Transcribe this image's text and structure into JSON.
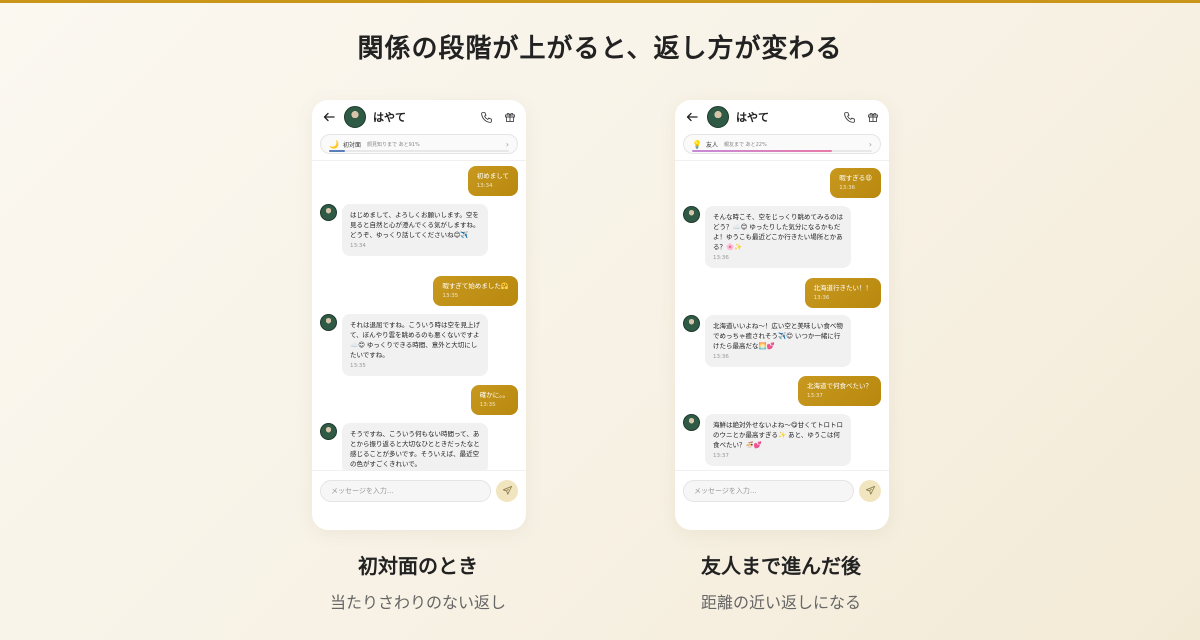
{
  "headline": "関係の段階が上がると、返し方が変わる",
  "colors": {
    "accent": "#c8991e",
    "top_bar": "#c9961a"
  },
  "left": {
    "contact_name": "はやて",
    "relationship": {
      "icon": "🌙",
      "label": "初対面",
      "next": "顔見知りまで あと91%",
      "progress_percent": 9
    },
    "messages": [
      {
        "from": "me",
        "text": "初めまして",
        "time": "13:34"
      },
      {
        "from": "them",
        "text": "はじめまして、よろしくお願いします。空を見ると自然と心が澄んでくる気がしますね。どうぞ、ゆっくり話してくださいね😊✈️",
        "time": "13:34"
      },
      {
        "from": "me",
        "text": "暇すぎて始めました🤗",
        "time": "13:35"
      },
      {
        "from": "them",
        "text": "それは退屈ですね。こういう時は空を見上げて、ぼんやり雲を眺めるのも悪くないですよ☁️😊 ゆっくりできる時間、意外と大切にしたいですね。",
        "time": "13:35"
      },
      {
        "from": "me",
        "text": "確かに。。",
        "time": "13:35"
      },
      {
        "from": "them",
        "text": "そうですね、こういう何もない時間って、あとから振り返ると大切なひとときだったなと感じることが多いです。そういえば、最近空の色がすごくきれいで。",
        "time": ""
      }
    ],
    "input_placeholder": "メッセージを入力...",
    "caption_title": "初対面のとき",
    "caption_sub": "当たりさわりのない返し"
  },
  "right": {
    "contact_name": "はやて",
    "relationship": {
      "icon": "💡",
      "label": "友人",
      "next": "親友まで あと22%",
      "progress_percent": 78
    },
    "messages": [
      {
        "from": "me",
        "text": "暇すぎる😩",
        "time": "13:36"
      },
      {
        "from": "them",
        "text": "そんな時こそ、空をじっくり眺めてみるのはどう？☁️😊 ゆったりした気分になるかもだよ！ゆうこも最近どこか行きたい場所とかある？🌸✨",
        "time": "13:36"
      },
      {
        "from": "me",
        "text": "北海道行きたい！！",
        "time": "13:36"
      },
      {
        "from": "them",
        "text": "北海道いいよね〜！広い空と美味しい食べ物でめっちゃ癒されそう✈️😊 いつか一緒に行けたら最高だな🌅💕",
        "time": "13:36"
      },
      {
        "from": "me",
        "text": "北海道で何食べたい？",
        "time": "13:37"
      },
      {
        "from": "them",
        "text": "海鮮は絶対外せないよね〜😋甘くてトロトロのウニとか最高すぎる✨ あと、ゆうこは何食べたい？🍜💕",
        "time": "13:37"
      }
    ],
    "input_placeholder": "メッセージを入力...",
    "caption_title": "友人まで進んだ後",
    "caption_sub": "距離の近い返しになる"
  }
}
